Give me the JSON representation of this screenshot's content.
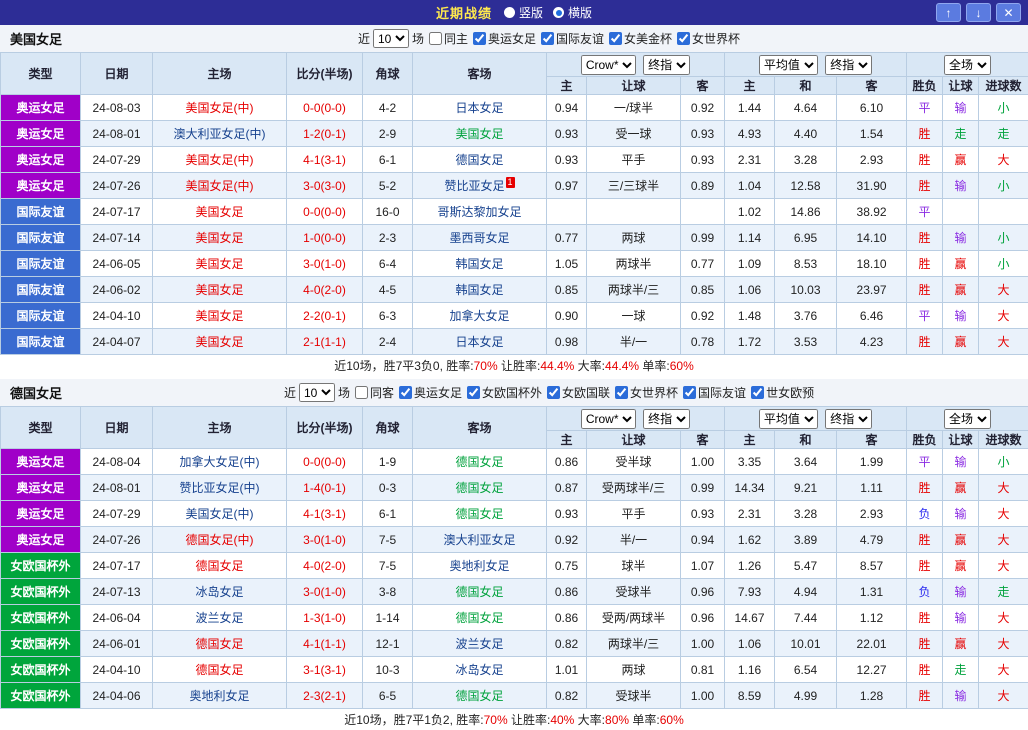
{
  "colors": {
    "type_bg": {
      "奥运女足": "#a000c8",
      "国际友谊": "#3a6bd0",
      "女欧国杯外": "#00a53c"
    },
    "team": {
      "red": "#e60000",
      "green": "#00a23c",
      "normal": "#16418e"
    },
    "score": "#e60000",
    "result": {
      "胜": "#e60000",
      "平": "#8a2be2",
      "负": "#2a2af0",
      "赢": "#e60000",
      "输": "#8a2be2",
      "走": "#00a23c",
      "大": "#e60000",
      "小": "#00a23c"
    }
  },
  "titlebar": {
    "title": "近期战绩",
    "radios": [
      {
        "label": "竖版",
        "selected": false
      },
      {
        "label": "横版",
        "selected": true
      }
    ],
    "buttons": [
      {
        "name": "scroll-up",
        "glyph": "↑"
      },
      {
        "name": "scroll-down",
        "glyph": "↓"
      },
      {
        "name": "close",
        "glyph": "✕"
      }
    ]
  },
  "table_header": {
    "col_type": "类型",
    "col_date": "日期",
    "col_home": "主场",
    "col_score": "比分(半场)",
    "col_corner": "角球",
    "col_away": "客场",
    "odds_select": "Crow*",
    "final_select": "终指",
    "avg_select": "平均值",
    "fulltime_select": "全场",
    "sub": {
      "home": "主",
      "handicap": "让球",
      "away": "客",
      "avg_home": "主",
      "avg_draw": "和",
      "avg_away": "客",
      "wdl": "胜负",
      "hcap_result": "让球",
      "goals": "进球数"
    }
  },
  "sections": [
    {
      "team": "美国女足",
      "filter": {
        "near": "近",
        "count": "10",
        "games": "场",
        "same": {
          "label": "同主",
          "checked": false
        },
        "comps": [
          {
            "label": "奥运女足",
            "checked": true
          },
          {
            "label": "国际友谊",
            "checked": true
          },
          {
            "label": "女美金杯",
            "checked": true
          },
          {
            "label": "女世界杯",
            "checked": true
          }
        ]
      },
      "rows": [
        {
          "type": "奥运女足",
          "date": "24-08-03",
          "home": "美国女足(中)",
          "home_c": "red",
          "score": "0-0(0-0)",
          "corner": "4-2",
          "away": "日本女足",
          "away_c": "normal",
          "badge": "",
          "o_home": "0.94",
          "o_hcap": "一/球半",
          "o_away": "0.92",
          "avg_home": "1.44",
          "avg_draw": "4.64",
          "avg_away": "6.10",
          "r_wdl": "平",
          "r_hcap": "输",
          "r_goal": "小"
        },
        {
          "type": "奥运女足",
          "date": "24-08-01",
          "home": "澳大利亚女足(中)",
          "home_c": "normal",
          "score": "1-2(0-1)",
          "corner": "2-9",
          "away": "美国女足",
          "away_c": "green",
          "badge": "",
          "o_home": "0.93",
          "o_hcap": "受一球",
          "o_away": "0.93",
          "avg_home": "4.93",
          "avg_draw": "4.40",
          "avg_away": "1.54",
          "r_wdl": "胜",
          "r_hcap": "走",
          "r_goal": "走"
        },
        {
          "type": "奥运女足",
          "date": "24-07-29",
          "home": "美国女足(中)",
          "home_c": "red",
          "score": "4-1(3-1)",
          "corner": "6-1",
          "away": "德国女足",
          "away_c": "normal",
          "badge": "",
          "o_home": "0.93",
          "o_hcap": "平手",
          "o_away": "0.93",
          "avg_home": "2.31",
          "avg_draw": "3.28",
          "avg_away": "2.93",
          "r_wdl": "胜",
          "r_hcap": "赢",
          "r_goal": "大"
        },
        {
          "type": "奥运女足",
          "date": "24-07-26",
          "home": "美国女足(中)",
          "home_c": "red",
          "score": "3-0(3-0)",
          "corner": "5-2",
          "away": "赞比亚女足",
          "away_c": "normal",
          "badge": "1",
          "o_home": "0.97",
          "o_hcap": "三/三球半",
          "o_away": "0.89",
          "avg_home": "1.04",
          "avg_draw": "12.58",
          "avg_away": "31.90",
          "r_wdl": "胜",
          "r_hcap": "输",
          "r_goal": "小"
        },
        {
          "type": "国际友谊",
          "date": "24-07-17",
          "home": "美国女足",
          "home_c": "red",
          "score": "0-0(0-0)",
          "corner": "16-0",
          "away": "哥斯达黎加女足",
          "away_c": "normal",
          "badge": "",
          "o_home": "",
          "o_hcap": "",
          "o_away": "",
          "avg_home": "1.02",
          "avg_draw": "14.86",
          "avg_away": "38.92",
          "r_wdl": "平",
          "r_hcap": "",
          "r_goal": ""
        },
        {
          "type": "国际友谊",
          "date": "24-07-14",
          "home": "美国女足",
          "home_c": "red",
          "score": "1-0(0-0)",
          "corner": "2-3",
          "away": "墨西哥女足",
          "away_c": "normal",
          "badge": "",
          "o_home": "0.77",
          "o_hcap": "两球",
          "o_away": "0.99",
          "avg_home": "1.14",
          "avg_draw": "6.95",
          "avg_away": "14.10",
          "r_wdl": "胜",
          "r_hcap": "输",
          "r_goal": "小"
        },
        {
          "type": "国际友谊",
          "date": "24-06-05",
          "home": "美国女足",
          "home_c": "red",
          "score": "3-0(1-0)",
          "corner": "6-4",
          "away": "韩国女足",
          "away_c": "normal",
          "badge": "",
          "o_home": "1.05",
          "o_hcap": "两球半",
          "o_away": "0.77",
          "avg_home": "1.09",
          "avg_draw": "8.53",
          "avg_away": "18.10",
          "r_wdl": "胜",
          "r_hcap": "赢",
          "r_goal": "小"
        },
        {
          "type": "国际友谊",
          "date": "24-06-02",
          "home": "美国女足",
          "home_c": "red",
          "score": "4-0(2-0)",
          "corner": "4-5",
          "away": "韩国女足",
          "away_c": "normal",
          "badge": "",
          "o_home": "0.85",
          "o_hcap": "两球半/三",
          "o_away": "0.85",
          "avg_home": "1.06",
          "avg_draw": "10.03",
          "avg_away": "23.97",
          "r_wdl": "胜",
          "r_hcap": "赢",
          "r_goal": "大"
        },
        {
          "type": "国际友谊",
          "date": "24-04-10",
          "home": "美国女足",
          "home_c": "red",
          "score": "2-2(0-1)",
          "corner": "6-3",
          "away": "加拿大女足",
          "away_c": "normal",
          "badge": "",
          "o_home": "0.90",
          "o_hcap": "一球",
          "o_away": "0.92",
          "avg_home": "1.48",
          "avg_draw": "3.76",
          "avg_away": "6.46",
          "r_wdl": "平",
          "r_hcap": "输",
          "r_goal": "大"
        },
        {
          "type": "国际友谊",
          "date": "24-04-07",
          "home": "美国女足",
          "home_c": "red",
          "score": "2-1(1-1)",
          "corner": "2-4",
          "away": "日本女足",
          "away_c": "normal",
          "badge": "",
          "o_home": "0.98",
          "o_hcap": "半/一",
          "o_away": "0.78",
          "avg_home": "1.72",
          "avg_draw": "3.53",
          "avg_away": "4.23",
          "r_wdl": "胜",
          "r_hcap": "赢",
          "r_goal": "大"
        }
      ],
      "summary": [
        {
          "text": "近10场，胜7平3负0, 胜率:",
          "color": "#222222"
        },
        {
          "text": "70%",
          "color": "#e60000"
        },
        {
          "text": " 让胜率:",
          "color": "#222222"
        },
        {
          "text": "44.4%",
          "color": "#e60000"
        },
        {
          "text": " 大率:",
          "color": "#222222"
        },
        {
          "text": "44.4%",
          "color": "#e60000"
        },
        {
          "text": " 单率:",
          "color": "#222222"
        },
        {
          "text": "60%",
          "color": "#e60000"
        }
      ]
    },
    {
      "team": "德国女足",
      "filter": {
        "near": "近",
        "count": "10",
        "games": "场",
        "same": {
          "label": "同客",
          "checked": false
        },
        "comps": [
          {
            "label": "奥运女足",
            "checked": true
          },
          {
            "label": "女欧国杯外",
            "checked": true
          },
          {
            "label": "女欧国联",
            "checked": true
          },
          {
            "label": "女世界杯",
            "checked": true
          },
          {
            "label": "国际友谊",
            "checked": true
          },
          {
            "label": "世女欧预",
            "checked": true
          }
        ]
      },
      "rows": [
        {
          "type": "奥运女足",
          "date": "24-08-04",
          "home": "加拿大女足(中)",
          "home_c": "normal",
          "score": "0-0(0-0)",
          "corner": "1-9",
          "away": "德国女足",
          "away_c": "green",
          "badge": "",
          "o_home": "0.86",
          "o_hcap": "受半球",
          "o_away": "1.00",
          "avg_home": "3.35",
          "avg_draw": "3.64",
          "avg_away": "1.99",
          "r_wdl": "平",
          "r_hcap": "输",
          "r_goal": "小"
        },
        {
          "type": "奥运女足",
          "date": "24-08-01",
          "home": "赞比亚女足(中)",
          "home_c": "normal",
          "score": "1-4(0-1)",
          "corner": "0-3",
          "away": "德国女足",
          "away_c": "green",
          "badge": "",
          "o_home": "0.87",
          "o_hcap": "受两球半/三",
          "o_away": "0.99",
          "avg_home": "14.34",
          "avg_draw": "9.21",
          "avg_away": "1.11",
          "r_wdl": "胜",
          "r_hcap": "赢",
          "r_goal": "大"
        },
        {
          "type": "奥运女足",
          "date": "24-07-29",
          "home": "美国女足(中)",
          "home_c": "normal",
          "score": "4-1(3-1)",
          "corner": "6-1",
          "away": "德国女足",
          "away_c": "green",
          "badge": "",
          "o_home": "0.93",
          "o_hcap": "平手",
          "o_away": "0.93",
          "avg_home": "2.31",
          "avg_draw": "3.28",
          "avg_away": "2.93",
          "r_wdl": "负",
          "r_hcap": "输",
          "r_goal": "大"
        },
        {
          "type": "奥运女足",
          "date": "24-07-26",
          "home": "德国女足(中)",
          "home_c": "red",
          "score": "3-0(1-0)",
          "corner": "7-5",
          "away": "澳大利亚女足",
          "away_c": "normal",
          "badge": "",
          "o_home": "0.92",
          "o_hcap": "半/一",
          "o_away": "0.94",
          "avg_home": "1.62",
          "avg_draw": "3.89",
          "avg_away": "4.79",
          "r_wdl": "胜",
          "r_hcap": "赢",
          "r_goal": "大"
        },
        {
          "type": "女欧国杯外",
          "date": "24-07-17",
          "home": "德国女足",
          "home_c": "red",
          "score": "4-0(2-0)",
          "corner": "7-5",
          "away": "奥地利女足",
          "away_c": "normal",
          "badge": "",
          "o_home": "0.75",
          "o_hcap": "球半",
          "o_away": "1.07",
          "avg_home": "1.26",
          "avg_draw": "5.47",
          "avg_away": "8.57",
          "r_wdl": "胜",
          "r_hcap": "赢",
          "r_goal": "大"
        },
        {
          "type": "女欧国杯外",
          "date": "24-07-13",
          "home": "冰岛女足",
          "home_c": "normal",
          "score": "3-0(1-0)",
          "corner": "3-8",
          "away": "德国女足",
          "away_c": "green",
          "badge": "",
          "o_home": "0.86",
          "o_hcap": "受球半",
          "o_away": "0.96",
          "avg_home": "7.93",
          "avg_draw": "4.94",
          "avg_away": "1.31",
          "r_wdl": "负",
          "r_hcap": "输",
          "r_goal": "走"
        },
        {
          "type": "女欧国杯外",
          "date": "24-06-04",
          "home": "波兰女足",
          "home_c": "normal",
          "score": "1-3(1-0)",
          "corner": "1-14",
          "away": "德国女足",
          "away_c": "green",
          "badge": "",
          "o_home": "0.86",
          "o_hcap": "受两/两球半",
          "o_away": "0.96",
          "avg_home": "14.67",
          "avg_draw": "7.44",
          "avg_away": "1.12",
          "r_wdl": "胜",
          "r_hcap": "输",
          "r_goal": "大"
        },
        {
          "type": "女欧国杯外",
          "date": "24-06-01",
          "home": "德国女足",
          "home_c": "red",
          "score": "4-1(1-1)",
          "corner": "12-1",
          "away": "波兰女足",
          "away_c": "normal",
          "badge": "",
          "o_home": "0.82",
          "o_hcap": "两球半/三",
          "o_away": "1.00",
          "avg_home": "1.06",
          "avg_draw": "10.01",
          "avg_away": "22.01",
          "r_wdl": "胜",
          "r_hcap": "赢",
          "r_goal": "大"
        },
        {
          "type": "女欧国杯外",
          "date": "24-04-10",
          "home": "德国女足",
          "home_c": "red",
          "score": "3-1(3-1)",
          "corner": "10-3",
          "away": "冰岛女足",
          "away_c": "normal",
          "badge": "",
          "o_home": "1.01",
          "o_hcap": "两球",
          "o_away": "0.81",
          "avg_home": "1.16",
          "avg_draw": "6.54",
          "avg_away": "12.27",
          "r_wdl": "胜",
          "r_hcap": "走",
          "r_goal": "大"
        },
        {
          "type": "女欧国杯外",
          "date": "24-04-06",
          "home": "奥地利女足",
          "home_c": "normal",
          "score": "2-3(2-1)",
          "corner": "6-5",
          "away": "德国女足",
          "away_c": "green",
          "badge": "",
          "o_home": "0.82",
          "o_hcap": "受球半",
          "o_away": "1.00",
          "avg_home": "8.59",
          "avg_draw": "4.99",
          "avg_away": "1.28",
          "r_wdl": "胜",
          "r_hcap": "输",
          "r_goal": "大"
        }
      ],
      "summary": [
        {
          "text": "近10场，胜7平1负2, 胜率:",
          "color": "#222222"
        },
        {
          "text": "70%",
          "color": "#e60000"
        },
        {
          "text": " 让胜率:",
          "color": "#222222"
        },
        {
          "text": "40%",
          "color": "#e60000"
        },
        {
          "text": " 大率:",
          "color": "#222222"
        },
        {
          "text": "80%",
          "color": "#e60000"
        },
        {
          "text": " 单率:",
          "color": "#222222"
        },
        {
          "text": "60%",
          "color": "#e60000"
        }
      ]
    }
  ]
}
